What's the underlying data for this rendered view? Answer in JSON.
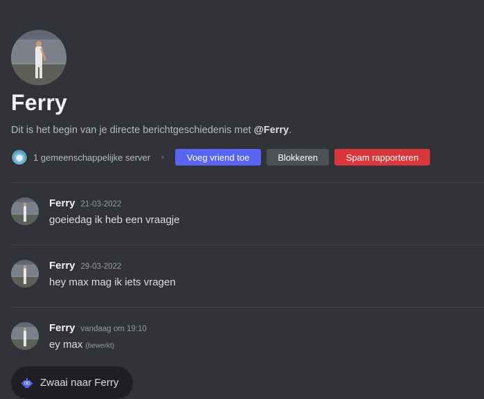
{
  "header": {
    "name": "Ferry",
    "intro_text": "Dit is het begin van je directe berichtgeschiedenis met ",
    "mention": "@Ferry",
    "intro_suffix": "."
  },
  "actions": {
    "mutual_servers": "1 gemeenschappelijke server",
    "add_friend": "Voeg vriend toe",
    "block": "Blokkeren",
    "report_spam": "Spam rapporteren"
  },
  "messages": [
    {
      "author": "Ferry",
      "timestamp": "21-03-2022",
      "text": "goeiedag ik heb een vraagje",
      "edited": ""
    },
    {
      "author": "Ferry",
      "timestamp": "29-03-2022",
      "text": "hey max mag ik iets vragen",
      "edited": ""
    },
    {
      "author": "Ferry",
      "timestamp": "vandaag om 19:10",
      "text": "ey max",
      "edited": "(bewerkt)"
    }
  ],
  "wave_button": {
    "label": "Zwaai naar Ferry",
    "icon": "wave-bot-icon"
  },
  "colors": {
    "background": "#313338",
    "primary": "#5865f2",
    "secondary": "#4e5058",
    "danger": "#da373c",
    "pill": "#1e1f22"
  }
}
